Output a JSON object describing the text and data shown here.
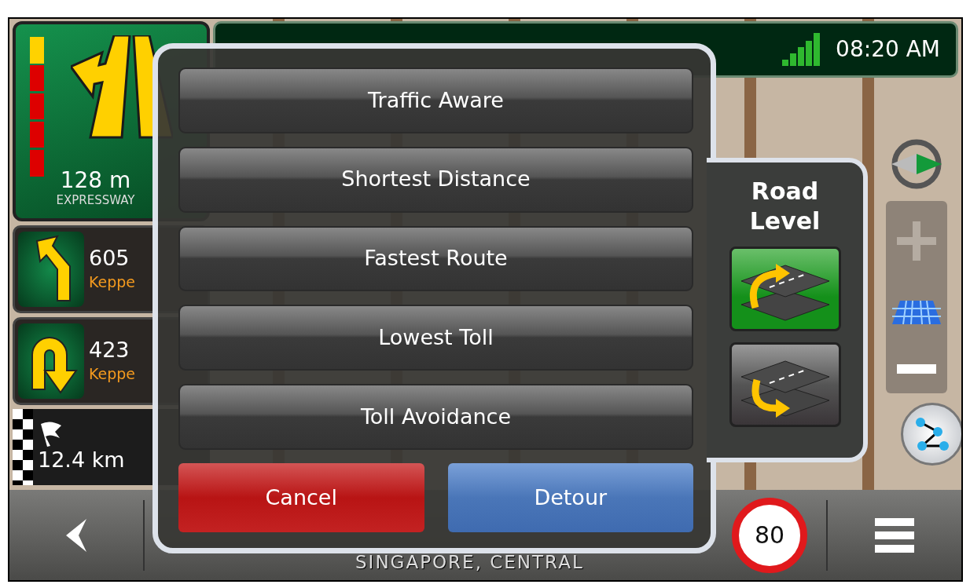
{
  "status_bar": {
    "time": "08:20 AM"
  },
  "current_maneuver": {
    "distance": "128 m",
    "road": "EXPRESSWAY"
  },
  "next_maneuvers": [
    {
      "kind": "turn-left",
      "distance": "605",
      "road": "Keppe"
    },
    {
      "kind": "u-turn",
      "distance": "423",
      "road": "Keppe"
    }
  ],
  "destination": {
    "distance": "12.4 km"
  },
  "route_dialog": {
    "options": [
      "Traffic Aware",
      "Shortest Distance",
      "Fastest Route",
      "Lowest Toll",
      "Toll Avoidance"
    ],
    "buttons": [
      {
        "label": "Cancel",
        "kind": "cancel"
      },
      {
        "label": "Detour",
        "kind": "confirm"
      }
    ]
  },
  "road_level": {
    "title": "Road Level",
    "options": [
      {
        "kind": "up",
        "selected": true
      },
      {
        "kind": "down",
        "selected": false
      }
    ]
  },
  "bottom_bar": {
    "location": "SINGAPORE, CENTRAL",
    "speed_limit": "80"
  }
}
